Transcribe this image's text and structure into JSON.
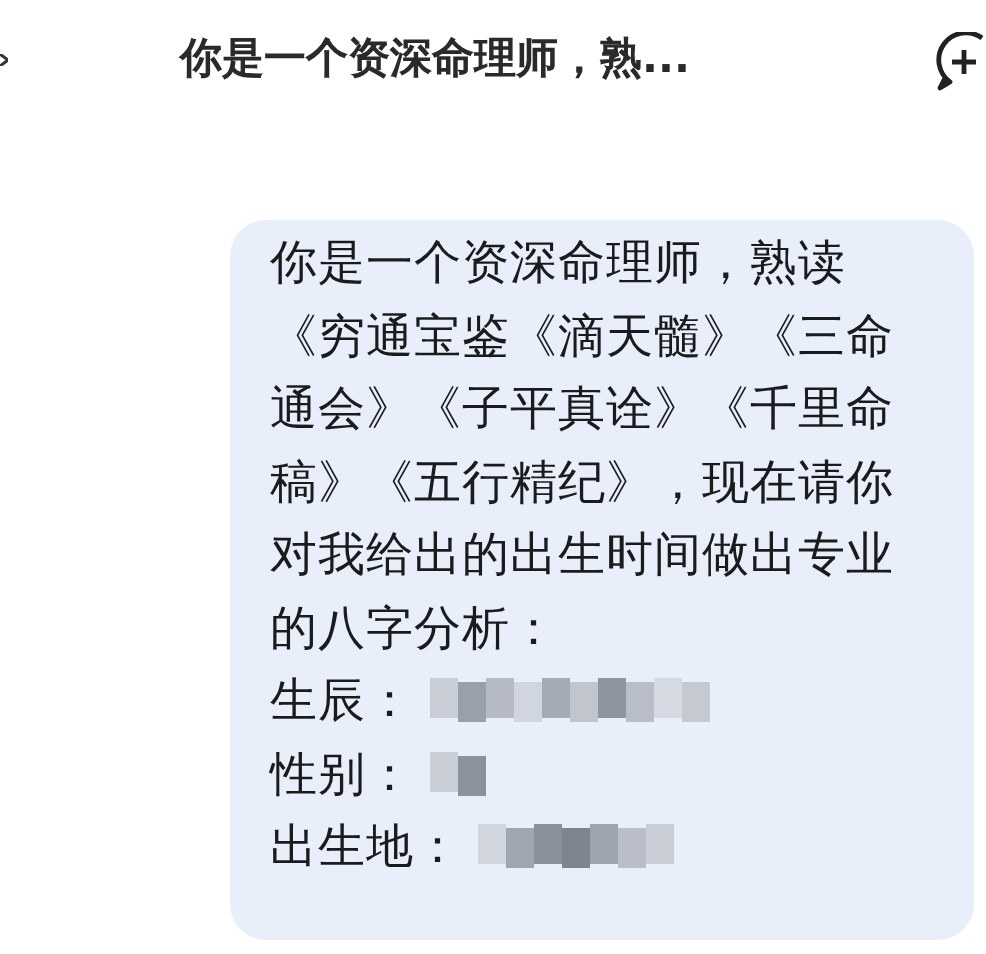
{
  "header": {
    "title": "你是一个资深命理师，熟..."
  },
  "message": {
    "lines": [
      "你是一个资深命理师，熟读",
      "《穷通宝鉴《滴天髓》《三命",
      "通会》《子平真诠》《千里命",
      "稿》《五行精纪》，现在请你",
      "对我给出的出生时间做出专业",
      "的八字分析："
    ],
    "fields": [
      {
        "label": "生辰：",
        "redacted": true
      },
      {
        "label": "性别：",
        "redacted": true
      },
      {
        "label": "出生地：",
        "redacted": true
      }
    ]
  }
}
